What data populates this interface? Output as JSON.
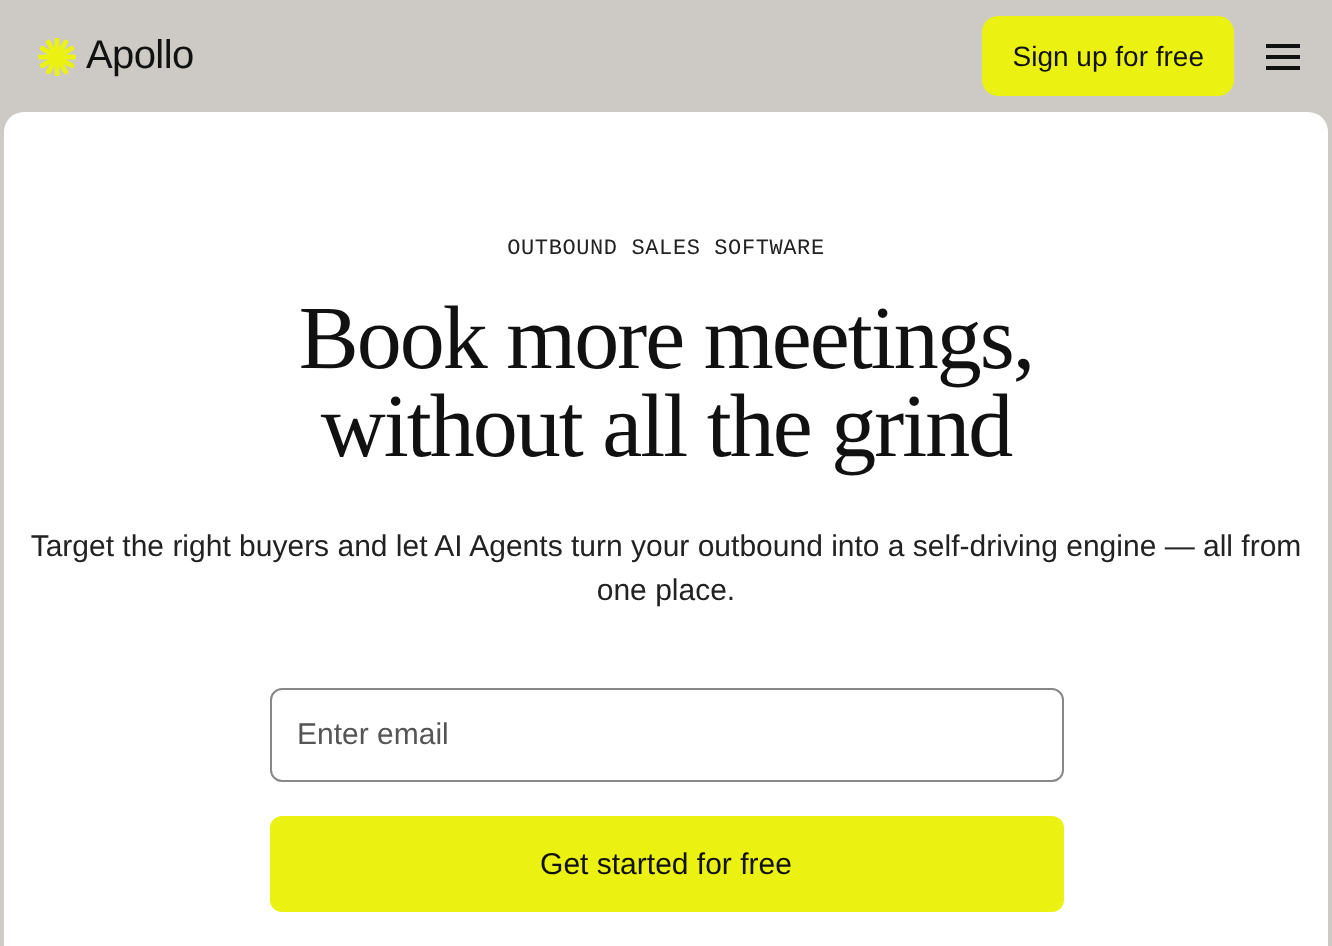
{
  "header": {
    "logo": "Apollo",
    "signup_button": "Sign up for free"
  },
  "hero": {
    "eyebrow": "OUTBOUND SALES SOFTWARE",
    "headline": [
      "Book more meetings,",
      "without all the grind"
    ],
    "subtitle": "Target the right buyers and let AI Agents turn your outbound into a self-driving engine — all from one place.",
    "email": {
      "placeholder": "Enter email"
    },
    "cta": "Get started for free"
  }
}
